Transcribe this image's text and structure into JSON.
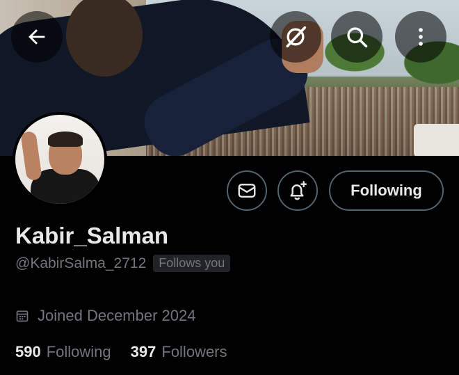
{
  "profile": {
    "display_name": "Kabir_Salman",
    "handle": "@KabirSalma_2712",
    "follows_you_badge": "Follows you",
    "joined": "Joined December 2024"
  },
  "actions": {
    "following_label": "Following"
  },
  "stats": {
    "following_count": "590",
    "following_label": "Following",
    "followers_count": "397",
    "followers_label": "Followers"
  },
  "icons": {
    "back": "arrow-left-icon",
    "grok": "grok-icon",
    "search": "search-icon",
    "more": "more-vertical-icon",
    "message": "envelope-icon",
    "notify": "bell-plus-icon",
    "calendar": "calendar-icon"
  },
  "colors": {
    "background": "#000000",
    "primary_text": "#e7e9ea",
    "secondary_text": "#71767b",
    "border": "#536471"
  }
}
